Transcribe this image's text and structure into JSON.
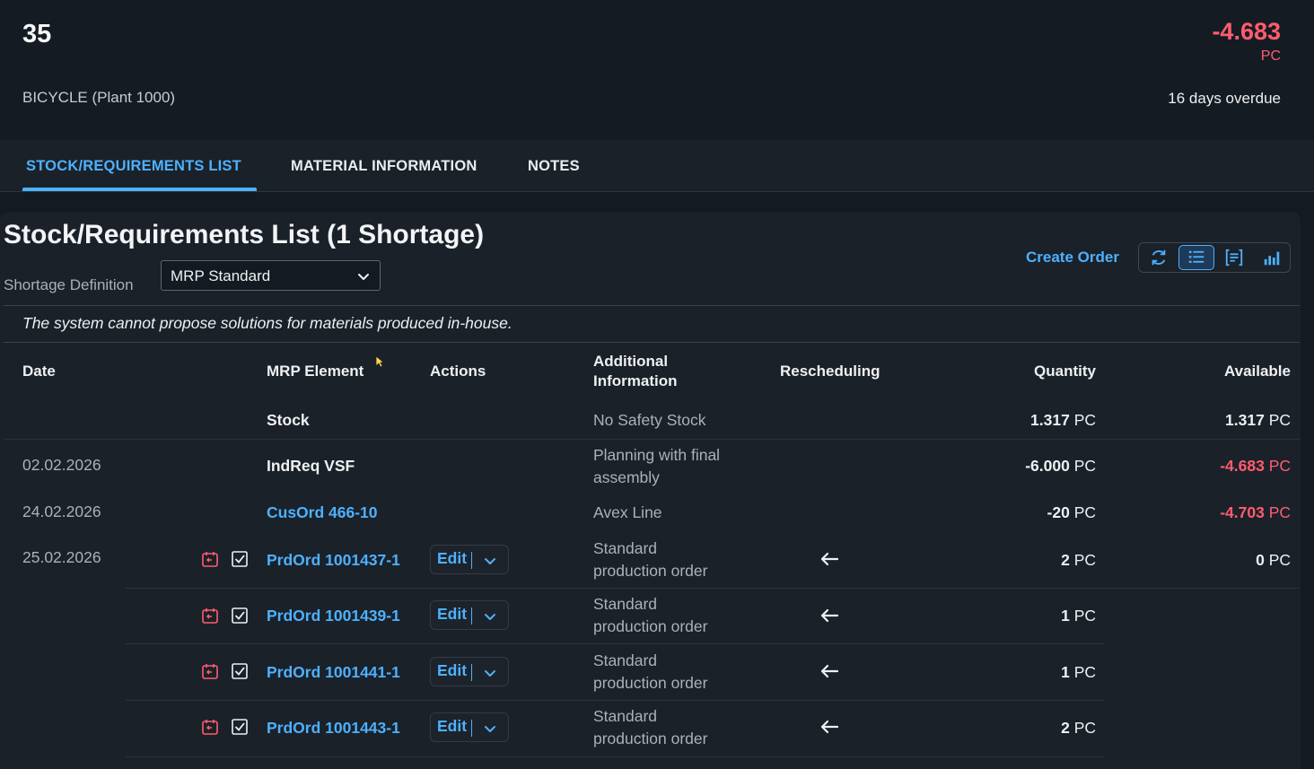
{
  "header": {
    "title": "35",
    "subtitle": "BICYCLE (Plant 1000)",
    "kpi_value": "-4.683",
    "kpi_unit": "PC",
    "status": "16 days overdue"
  },
  "tabs": [
    {
      "label": "STOCK/REQUIREMENTS LIST",
      "active": true
    },
    {
      "label": "MATERIAL INFORMATION",
      "active": false
    },
    {
      "label": "NOTES",
      "active": false
    }
  ],
  "section": {
    "title": "Stock/Requirements List (1 Shortage)",
    "filter_label": "Shortage Definition",
    "filter_value": "MRP Standard",
    "create_order": "Create Order",
    "message": "The system cannot propose solutions for materials produced in-house."
  },
  "toolbar": {
    "icons": [
      "refresh-icon",
      "list-view-icon",
      "detail-view-icon",
      "chart-view-icon"
    ],
    "selected": "list-view-icon"
  },
  "columns": {
    "date": "Date",
    "mrp_element": "MRP Element",
    "actions": "Actions",
    "additional_line1": "Additional",
    "additional_line2": "Information",
    "rescheduling": "Rescheduling",
    "quantity": "Quantity",
    "available": "Available"
  },
  "rows": [
    {
      "date": "",
      "element": "Stock",
      "info1": "No Safety Stock",
      "info2": "",
      "qty": "1.317",
      "qty_unit": "PC",
      "avail": "1.317",
      "avail_unit": "PC"
    },
    {
      "date": "02.02.2026",
      "element": "IndReq VSF",
      "info1": "Planning with final",
      "info2": "assembly",
      "qty": "-6.000",
      "qty_unit": "PC",
      "avail": "-4.683",
      "avail_unit": "PC"
    },
    {
      "date": "24.02.2026",
      "element": "CusOrd 466-10",
      "info1": "Avex Line",
      "info2": "",
      "qty": "-20",
      "qty_unit": "PC",
      "avail": "-4.703",
      "avail_unit": "PC"
    },
    {
      "date": "25.02.2026",
      "element": "PrdOrd 1001437-1",
      "edit": "Edit",
      "info1": "Standard",
      "info2": "production order",
      "qty": "2",
      "qty_unit": "PC",
      "avail": "0",
      "avail_unit": "PC"
    },
    {
      "date": "",
      "element": "PrdOrd 1001439-1",
      "edit": "Edit",
      "info1": "Standard",
      "info2": "production order",
      "qty": "1",
      "qty_unit": "PC",
      "avail": "",
      "avail_unit": ""
    },
    {
      "date": "",
      "element": "PrdOrd 1001441-1",
      "edit": "Edit",
      "info1": "Standard",
      "info2": "production order",
      "qty": "1",
      "qty_unit": "PC",
      "avail": "",
      "avail_unit": ""
    },
    {
      "date": "",
      "element": "PrdOrd 1001443-1",
      "edit": "Edit",
      "info1": "Standard",
      "info2": "production order",
      "qty": "2",
      "qty_unit": "PC",
      "avail": "",
      "avail_unit": ""
    }
  ],
  "colors": {
    "accent": "#4db1ff",
    "negative": "#ff5c6f",
    "background": "#141a21"
  }
}
